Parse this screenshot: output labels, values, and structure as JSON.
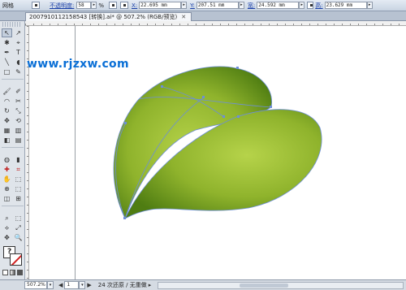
{
  "control_bar": {
    "title": "网格",
    "opacity_label": "不透明度:",
    "opacity_value": "58",
    "opacity_unit": "%",
    "x_label": "X:",
    "x_value": "22.695 mm",
    "y_label": "Y:",
    "y_value": "207.51 mm",
    "w_label": "宽:",
    "w_value": "24.592 mm",
    "h_label": "高:",
    "h_value": "23.629 mm"
  },
  "document_tab": {
    "label": "2007910112158543 [转换].ai* @ 507.2% (RGB/预览)",
    "close_glyph": "✕"
  },
  "tools": [
    "↖",
    "↗",
    "✱",
    "⌖",
    "✒",
    "T",
    "╲",
    "◖",
    "□",
    "✎",
    "🖌",
    "✐",
    "◠",
    "✂",
    "↻",
    "⤡",
    "✥",
    "⟲",
    "▦",
    "▥",
    "◧",
    "▤",
    "◍",
    "▮",
    "✚",
    "⌗",
    "✋",
    "⬚",
    "⊕",
    "⬚",
    "◫",
    "⊞",
    "⌕",
    "⬚",
    "⟡",
    "⤢",
    "✥",
    "🔍"
  ],
  "watermark": "www.rjzxw.com",
  "leaf": {
    "fill_light": "#b6d34a",
    "fill_mid": "#8fb32c",
    "fill_dark": "#4f7d12",
    "path_color": "#6d8fd6"
  },
  "fill_box_glyph": "?",
  "status_bar": {
    "zoom": "507.2%",
    "page": "1",
    "nav_prev": "◀",
    "nav_next": "▶",
    "message": "24 次还原 / 无重做"
  }
}
